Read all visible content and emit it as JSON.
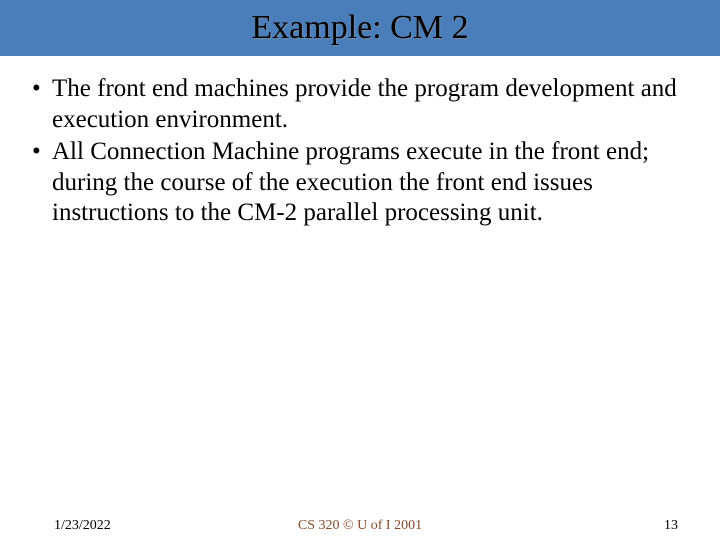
{
  "title": "Example: CM 2",
  "bullets": [
    "The front end machines provide the program development and execution environment.",
    "All Connection Machine programs execute in the front end; during the course of the execution the front end issues instructions to the CM-2 parallel processing unit."
  ],
  "footer": {
    "date": "1/23/2022",
    "center": "CS 320 © U of I 2001",
    "page": "13"
  }
}
